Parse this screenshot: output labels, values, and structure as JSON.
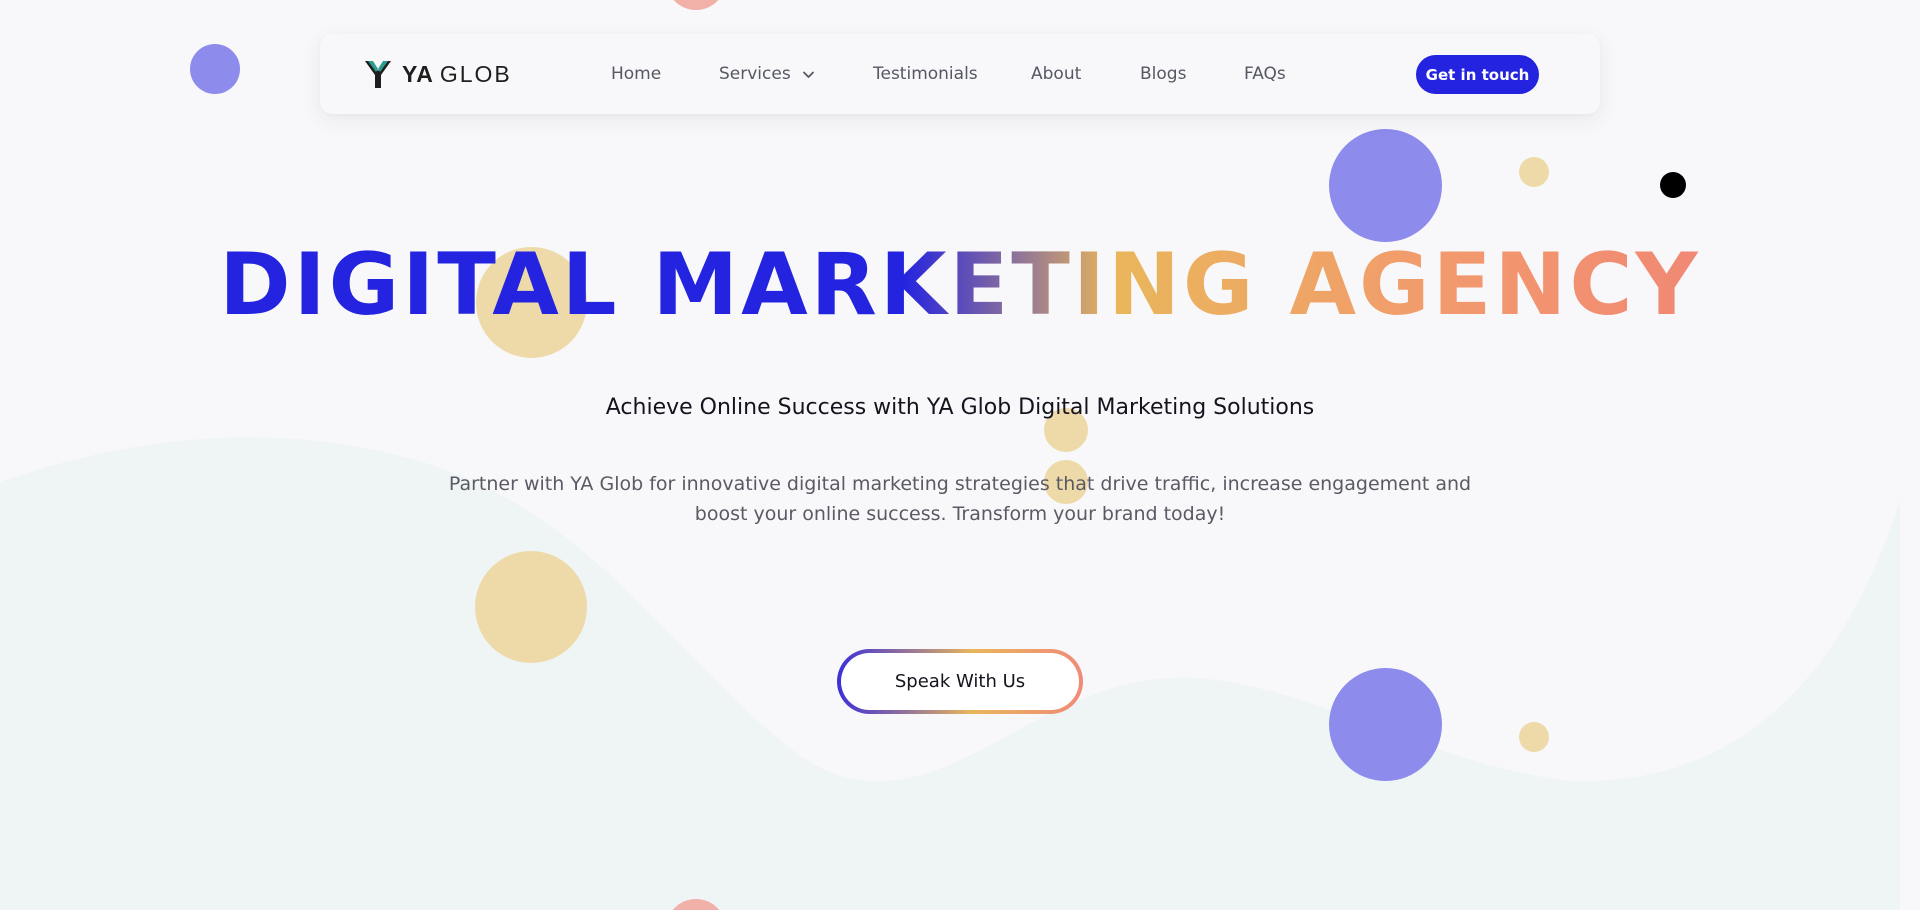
{
  "brand": {
    "name_bold": "YA",
    "name_light": "GLOB",
    "accent": "#2323e0",
    "gradient": [
      "#2323e0",
      "#e9b65b",
      "#f29a6d",
      "#f0797a"
    ]
  },
  "nav": {
    "items": [
      {
        "label": "Home"
      },
      {
        "label": "Services",
        "has_dropdown": true
      },
      {
        "label": "Testimonials"
      },
      {
        "label": "About"
      },
      {
        "label": "Blogs"
      },
      {
        "label": "FAQs"
      }
    ],
    "cta_label": "Get in touch"
  },
  "hero": {
    "title": "DIGITAL MARKETING AGENCY",
    "subtitle": "Achieve Online Success with YA Glob Digital Marketing Solutions",
    "description": "Partner with YA Glob for innovative digital marketing strategies that drive traffic, increase engagement and boost your online success. Transform your brand today!",
    "button_label": "Speak With Us"
  },
  "icons": {
    "logo": "ya-glob-logo-icon",
    "dropdown": "chevron-down-icon"
  }
}
